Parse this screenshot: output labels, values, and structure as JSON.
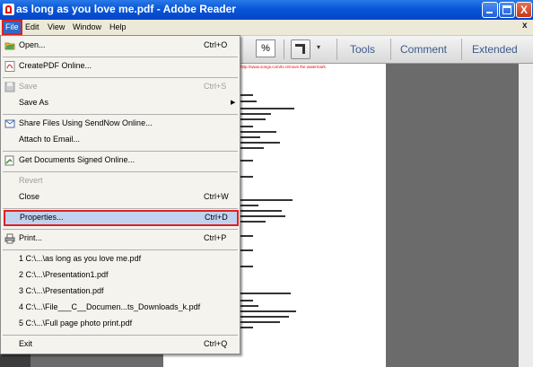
{
  "window": {
    "title": "as long as you love me.pdf - Adobe Reader",
    "close_symbol": "X"
  },
  "menubar": {
    "items": [
      "File",
      "Edit",
      "View",
      "Window",
      "Help"
    ],
    "doc_close": "x"
  },
  "toolbar": {
    "zoom_suffix": "%",
    "dropdown_arrow": "▾",
    "tools_label": "Tools",
    "comment_label": "Comment",
    "extended_label": "Extended"
  },
  "document": {
    "top_line": "http://www.songs.com/to remove the watermark."
  },
  "file_menu": {
    "items": [
      {
        "label": "Open...",
        "shortcut": "Ctrl+O",
        "icon": "open-folder-icon",
        "enabled": true
      },
      {
        "label": "CreatePDF Online...",
        "shortcut": "",
        "icon": "create-pdf-icon",
        "enabled": true
      },
      {
        "label": "Save",
        "shortcut": "Ctrl+S",
        "icon": "save-icon",
        "enabled": false
      },
      {
        "label": "Save As",
        "shortcut": "",
        "icon": "",
        "enabled": true,
        "submenu": true
      },
      {
        "label": "Share Files Using SendNow Online...",
        "shortcut": "",
        "icon": "share-icon",
        "enabled": true
      },
      {
        "label": "Attach to Email...",
        "shortcut": "",
        "icon": "",
        "enabled": true
      },
      {
        "label": "Get Documents Signed Online...",
        "shortcut": "",
        "icon": "sign-icon",
        "enabled": true
      },
      {
        "label": "Revert",
        "shortcut": "",
        "icon": "",
        "enabled": false
      },
      {
        "label": "Close",
        "shortcut": "Ctrl+W",
        "icon": "",
        "enabled": true
      },
      {
        "label": "Properties...",
        "shortcut": "Ctrl+D",
        "icon": "",
        "enabled": true,
        "highlighted": true
      },
      {
        "label": "Print...",
        "shortcut": "Ctrl+P",
        "icon": "printer-icon",
        "enabled": true
      },
      {
        "label": "1 C:\\...\\as long as you love me.pdf",
        "shortcut": "",
        "icon": "",
        "enabled": true
      },
      {
        "label": "2 C:\\...\\Presentation1.pdf",
        "shortcut": "",
        "icon": "",
        "enabled": true
      },
      {
        "label": "3 C:\\...\\Presentation.pdf",
        "shortcut": "",
        "icon": "",
        "enabled": true
      },
      {
        "label": "4 C:\\...\\File___C__Documen...ts_Downloads_k.pdf",
        "shortcut": "",
        "icon": "",
        "enabled": true
      },
      {
        "label": "5 C:\\...\\Full page photo print.pdf",
        "shortcut": "",
        "icon": "",
        "enabled": true
      },
      {
        "label": "Exit",
        "shortcut": "Ctrl+Q",
        "icon": "",
        "enabled": true
      }
    ],
    "submenu_arrow": "▶"
  },
  "colors": {
    "titlebar": "#0a56d8",
    "highlight": "#c1d2ee",
    "annotation": "#e02020",
    "watermark_text": "#e00000"
  }
}
